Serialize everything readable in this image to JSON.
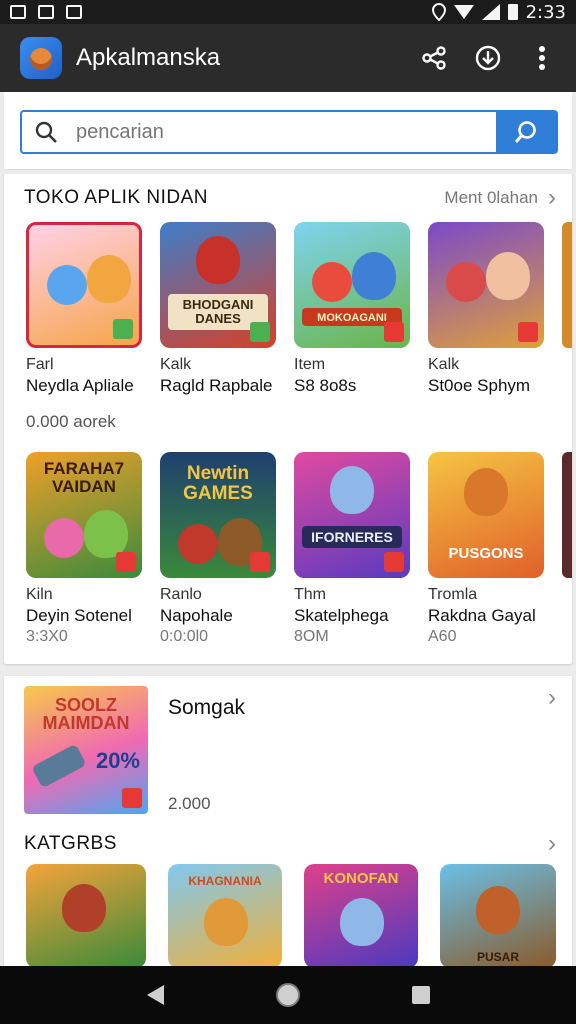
{
  "status_bar": {
    "time": "2:33"
  },
  "app_bar": {
    "title": "Apkalmanska",
    "icons": [
      "share-icon",
      "download-icon",
      "more-vert-icon"
    ]
  },
  "search": {
    "placeholder": "pencarian",
    "value": ""
  },
  "section1": {
    "title": "TOKO APLIK NIDAN",
    "more_label": "Ment 0lahan",
    "row1": [
      {
        "category": "Farl",
        "name": "Neydla Apliale",
        "sub": ""
      },
      {
        "category": "Kalk",
        "name": "Ragld Rapbale",
        "sub": ""
      },
      {
        "category": "Item",
        "name": "S8 8o8s",
        "sub": ""
      },
      {
        "category": "Kalk",
        "name": "St0oe Sphym",
        "sub": ""
      }
    ],
    "row1_footer": "0.000 aorek",
    "row1_art": [
      "",
      "BHODGANI DANES",
      "MOKOAGANI",
      ""
    ],
    "row2": [
      {
        "category": "Kiln",
        "name": "Deyin Sotenel",
        "sub": "3:3X0",
        "art": "FARAHA7 VAIDAN"
      },
      {
        "category": "Ranlo",
        "name": "Napohale",
        "sub": "0:0:0l0",
        "art": "Newtin GAMES"
      },
      {
        "category": "Thm",
        "name": "Skatelphega",
        "sub": "8OM",
        "art": "IFORNERES"
      },
      {
        "category": "Tromla",
        "name": "Rakdna Gayal",
        "sub": "A60",
        "art": "PUSGONS"
      }
    ]
  },
  "section2": {
    "featured": {
      "art": "SOOLZ MAIMDAN",
      "badge": "20%",
      "title": "Somgak",
      "price": "2.000"
    },
    "categories_title": "KATGRBS",
    "category_tiles": [
      "",
      "KHAGNANIA",
      "KONOFAN",
      "PUSAR"
    ]
  },
  "colors": {
    "accent": "#2f7fd8",
    "app_bar": "#2b2b2b",
    "badge": "#e53935"
  }
}
